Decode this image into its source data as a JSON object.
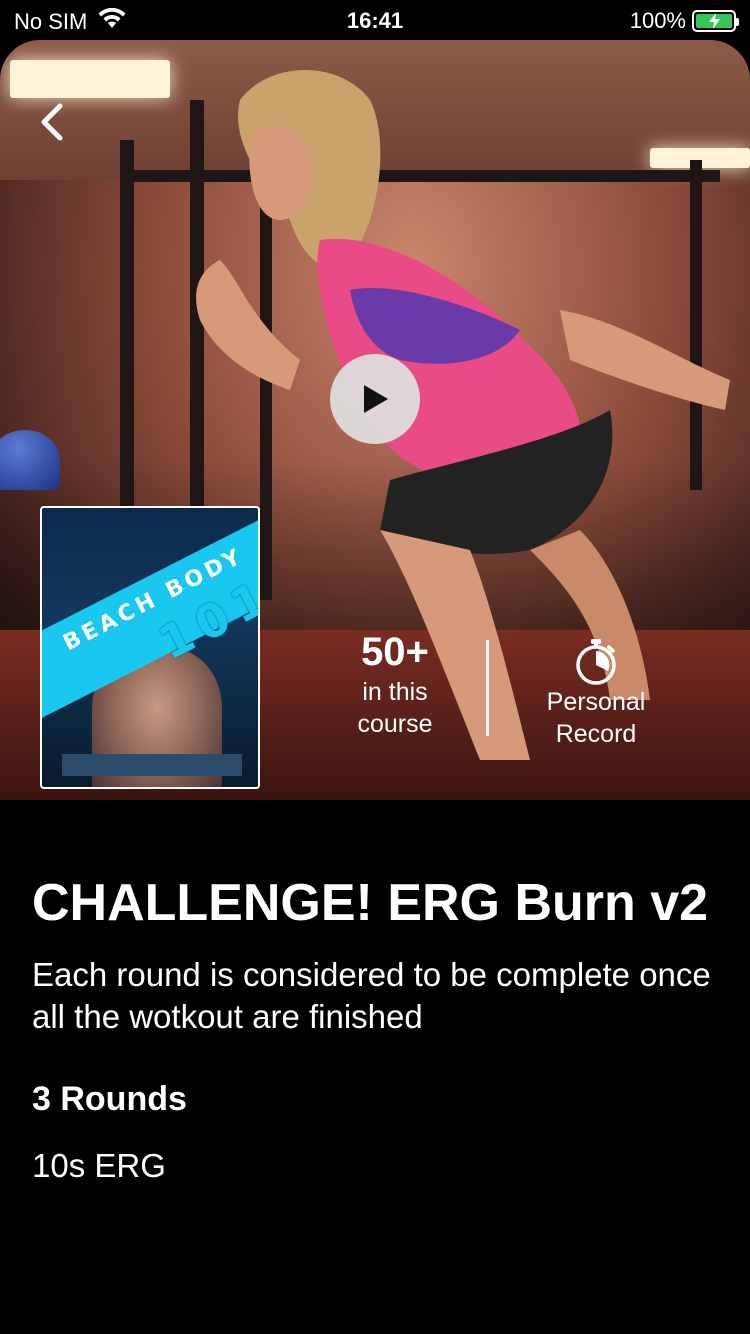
{
  "status_bar": {
    "carrier": "No SIM",
    "time": "16:41",
    "battery": "100%"
  },
  "hero": {
    "cover": {
      "line1": "BEACH BODY",
      "line2": "101"
    },
    "stats": {
      "course_count": "50+",
      "course_label_1": "in this",
      "course_label_2": "course",
      "record_label_1": "Personal",
      "record_label_2": "Record"
    }
  },
  "workout": {
    "title": "CHALLENGE! ERG Burn v2",
    "description": "Each round is considered to be complete once all the wotkout are finished",
    "rounds": "3 Rounds",
    "exercises": [
      "10s ERG"
    ]
  },
  "icons": {
    "back": "chevron-left-icon",
    "play": "play-icon",
    "record": "stopwatch-icon",
    "wifi": "wifi-icon",
    "battery": "battery-charging-icon"
  },
  "colors": {
    "background": "#000000",
    "accent_cyan": "#19c7ef",
    "battery_green": "#35c759"
  }
}
